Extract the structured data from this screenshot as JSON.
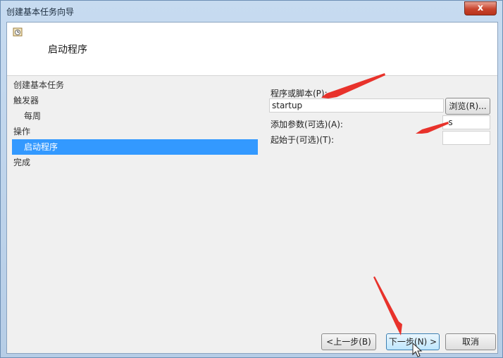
{
  "window": {
    "title": "创建基本任务向导",
    "close_label": "x"
  },
  "header": {
    "title": "启动程序"
  },
  "nav": {
    "items": [
      {
        "label": "创建基本任务"
      },
      {
        "label": "触发器"
      },
      {
        "label": "每周"
      },
      {
        "label": "操作"
      },
      {
        "label": "启动程序"
      },
      {
        "label": "完成"
      }
    ]
  },
  "form": {
    "program_label": "程序或脚本(P):",
    "program_value": "startup",
    "browse_label": "浏览(R)...",
    "args_label": "添加参数(可选)(A):",
    "args_value": "-s",
    "startin_label": "起始于(可选)(T):",
    "startin_value": ""
  },
  "footer": {
    "back_label": "<上一步(B)",
    "next_label": "下一步(N) >",
    "cancel_label": "取消"
  },
  "colors": {
    "selected": "#3399ff",
    "annotation_arrow": "#e8322b"
  }
}
